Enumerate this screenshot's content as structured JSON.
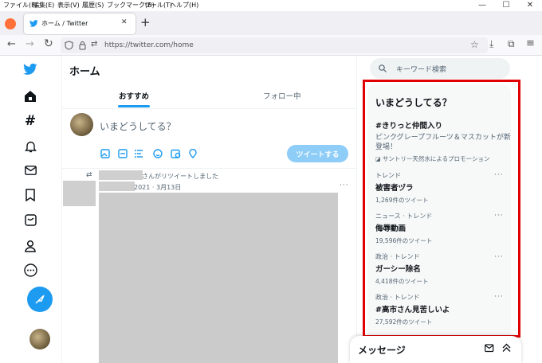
{
  "browser": {
    "menu": [
      "ファイル(F)",
      "編集(E)",
      "表示(V)",
      "履歴(S)",
      "ブックマーク(B)",
      "ツール(T)",
      "ヘルプ(H)"
    ],
    "window_controls": [
      "—",
      "☐",
      "✕"
    ],
    "tab_title": "ホーム / Twitter",
    "tab_close": "✕",
    "new_tab": "+",
    "url": "https://twitter.com/home"
  },
  "main": {
    "title": "ホーム",
    "tabs": [
      "おすすめ",
      "フォロー中"
    ],
    "composer_placeholder": "いまどうしてる？",
    "tweet_button": "ツイートする",
    "retweet_notice": "さんがリツイートしました",
    "tweet_date": "2021 · 3月13日",
    "more": "···"
  },
  "sidebar": {
    "search_placeholder": "キーワード検索",
    "trends_title": "いまどうしてる？",
    "promo": {
      "title": "#きりっと仲間入り",
      "text": "ピンクグレープフルーツ＆マスカットが新登場！",
      "sponsor": "サントリー天然水によるプロモーション"
    },
    "trends": [
      {
        "meta": "トレンド",
        "name": "被害者ヅラ",
        "count": "1,269件のツイート"
      },
      {
        "meta": "ニュース · トレンド",
        "name": "侮辱動画",
        "count": "19,596件のツイート"
      },
      {
        "meta": "政治 · トレンド",
        "name": "ガーシー除名",
        "count": "4,418件のツイート"
      },
      {
        "meta": "政治 · トレンド",
        "name": "#高市さん見苦しいよ",
        "count": "27,592件のツイート"
      }
    ],
    "messages_title": "メッセージ"
  },
  "colors": {
    "twitter_blue": "#1d9bf0",
    "highlight_red": "#e00000",
    "tweet_button_disabled": "#8ecdf8"
  }
}
